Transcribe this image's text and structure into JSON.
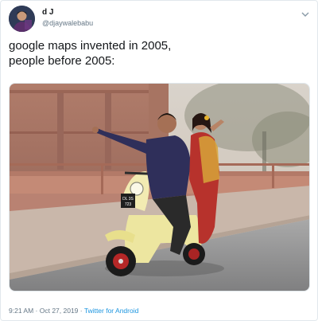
{
  "tweet": {
    "display_name": "d J",
    "handle": "@djaywalebabu",
    "text_line1": "google maps invented in 2005,",
    "text_line2": "people before 2005:",
    "timestamp": "9:21 AM · Oct 27, 2019",
    "separator": " · ",
    "source": "Twitter for Android",
    "scooter_plate_line1": "DL 3S",
    "scooter_plate_line2": "723"
  },
  "icons": {
    "more": "chevron-down-icon",
    "avatar": "avatar"
  },
  "colors": {
    "link": "#1b95e0",
    "secondary_text": "#657786",
    "primary_text": "#14171a",
    "border": "#e1e8ed"
  }
}
